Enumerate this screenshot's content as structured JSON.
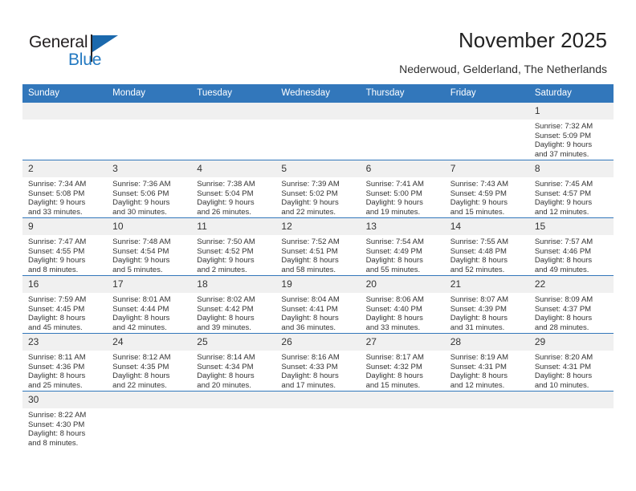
{
  "brand": {
    "name_part1": "General",
    "name_part2": "Blue",
    "flag_icon": "blue-triangle-flag-icon",
    "colors": {
      "dark": "#231f20",
      "blue": "#2379c1",
      "flag": "#1b69ad"
    }
  },
  "header": {
    "title": "November 2025",
    "subtitle": "Nederwoud, Gelderland, The Netherlands"
  },
  "calendar": {
    "accent_color": "#3277bb",
    "daynum_bg": "#f0f0f0",
    "weekday_headers": [
      "Sunday",
      "Monday",
      "Tuesday",
      "Wednesday",
      "Thursday",
      "Friday",
      "Saturday"
    ],
    "weeks": [
      [
        {
          "empty": true
        },
        {
          "empty": true
        },
        {
          "empty": true
        },
        {
          "empty": true
        },
        {
          "empty": true
        },
        {
          "empty": true
        },
        {
          "day": "1",
          "sunrise": "Sunrise: 7:32 AM",
          "sunset": "Sunset: 5:09 PM",
          "daylight1": "Daylight: 9 hours",
          "daylight2": "and 37 minutes."
        }
      ],
      [
        {
          "day": "2",
          "sunrise": "Sunrise: 7:34 AM",
          "sunset": "Sunset: 5:08 PM",
          "daylight1": "Daylight: 9 hours",
          "daylight2": "and 33 minutes."
        },
        {
          "day": "3",
          "sunrise": "Sunrise: 7:36 AM",
          "sunset": "Sunset: 5:06 PM",
          "daylight1": "Daylight: 9 hours",
          "daylight2": "and 30 minutes."
        },
        {
          "day": "4",
          "sunrise": "Sunrise: 7:38 AM",
          "sunset": "Sunset: 5:04 PM",
          "daylight1": "Daylight: 9 hours",
          "daylight2": "and 26 minutes."
        },
        {
          "day": "5",
          "sunrise": "Sunrise: 7:39 AM",
          "sunset": "Sunset: 5:02 PM",
          "daylight1": "Daylight: 9 hours",
          "daylight2": "and 22 minutes."
        },
        {
          "day": "6",
          "sunrise": "Sunrise: 7:41 AM",
          "sunset": "Sunset: 5:00 PM",
          "daylight1": "Daylight: 9 hours",
          "daylight2": "and 19 minutes."
        },
        {
          "day": "7",
          "sunrise": "Sunrise: 7:43 AM",
          "sunset": "Sunset: 4:59 PM",
          "daylight1": "Daylight: 9 hours",
          "daylight2": "and 15 minutes."
        },
        {
          "day": "8",
          "sunrise": "Sunrise: 7:45 AM",
          "sunset": "Sunset: 4:57 PM",
          "daylight1": "Daylight: 9 hours",
          "daylight2": "and 12 minutes."
        }
      ],
      [
        {
          "day": "9",
          "sunrise": "Sunrise: 7:47 AM",
          "sunset": "Sunset: 4:55 PM",
          "daylight1": "Daylight: 9 hours",
          "daylight2": "and 8 minutes."
        },
        {
          "day": "10",
          "sunrise": "Sunrise: 7:48 AM",
          "sunset": "Sunset: 4:54 PM",
          "daylight1": "Daylight: 9 hours",
          "daylight2": "and 5 minutes."
        },
        {
          "day": "11",
          "sunrise": "Sunrise: 7:50 AM",
          "sunset": "Sunset: 4:52 PM",
          "daylight1": "Daylight: 9 hours",
          "daylight2": "and 2 minutes."
        },
        {
          "day": "12",
          "sunrise": "Sunrise: 7:52 AM",
          "sunset": "Sunset: 4:51 PM",
          "daylight1": "Daylight: 8 hours",
          "daylight2": "and 58 minutes."
        },
        {
          "day": "13",
          "sunrise": "Sunrise: 7:54 AM",
          "sunset": "Sunset: 4:49 PM",
          "daylight1": "Daylight: 8 hours",
          "daylight2": "and 55 minutes."
        },
        {
          "day": "14",
          "sunrise": "Sunrise: 7:55 AM",
          "sunset": "Sunset: 4:48 PM",
          "daylight1": "Daylight: 8 hours",
          "daylight2": "and 52 minutes."
        },
        {
          "day": "15",
          "sunrise": "Sunrise: 7:57 AM",
          "sunset": "Sunset: 4:46 PM",
          "daylight1": "Daylight: 8 hours",
          "daylight2": "and 49 minutes."
        }
      ],
      [
        {
          "day": "16",
          "sunrise": "Sunrise: 7:59 AM",
          "sunset": "Sunset: 4:45 PM",
          "daylight1": "Daylight: 8 hours",
          "daylight2": "and 45 minutes."
        },
        {
          "day": "17",
          "sunrise": "Sunrise: 8:01 AM",
          "sunset": "Sunset: 4:44 PM",
          "daylight1": "Daylight: 8 hours",
          "daylight2": "and 42 minutes."
        },
        {
          "day": "18",
          "sunrise": "Sunrise: 8:02 AM",
          "sunset": "Sunset: 4:42 PM",
          "daylight1": "Daylight: 8 hours",
          "daylight2": "and 39 minutes."
        },
        {
          "day": "19",
          "sunrise": "Sunrise: 8:04 AM",
          "sunset": "Sunset: 4:41 PM",
          "daylight1": "Daylight: 8 hours",
          "daylight2": "and 36 minutes."
        },
        {
          "day": "20",
          "sunrise": "Sunrise: 8:06 AM",
          "sunset": "Sunset: 4:40 PM",
          "daylight1": "Daylight: 8 hours",
          "daylight2": "and 33 minutes."
        },
        {
          "day": "21",
          "sunrise": "Sunrise: 8:07 AM",
          "sunset": "Sunset: 4:39 PM",
          "daylight1": "Daylight: 8 hours",
          "daylight2": "and 31 minutes."
        },
        {
          "day": "22",
          "sunrise": "Sunrise: 8:09 AM",
          "sunset": "Sunset: 4:37 PM",
          "daylight1": "Daylight: 8 hours",
          "daylight2": "and 28 minutes."
        }
      ],
      [
        {
          "day": "23",
          "sunrise": "Sunrise: 8:11 AM",
          "sunset": "Sunset: 4:36 PM",
          "daylight1": "Daylight: 8 hours",
          "daylight2": "and 25 minutes."
        },
        {
          "day": "24",
          "sunrise": "Sunrise: 8:12 AM",
          "sunset": "Sunset: 4:35 PM",
          "daylight1": "Daylight: 8 hours",
          "daylight2": "and 22 minutes."
        },
        {
          "day": "25",
          "sunrise": "Sunrise: 8:14 AM",
          "sunset": "Sunset: 4:34 PM",
          "daylight1": "Daylight: 8 hours",
          "daylight2": "and 20 minutes."
        },
        {
          "day": "26",
          "sunrise": "Sunrise: 8:16 AM",
          "sunset": "Sunset: 4:33 PM",
          "daylight1": "Daylight: 8 hours",
          "daylight2": "and 17 minutes."
        },
        {
          "day": "27",
          "sunrise": "Sunrise: 8:17 AM",
          "sunset": "Sunset: 4:32 PM",
          "daylight1": "Daylight: 8 hours",
          "daylight2": "and 15 minutes."
        },
        {
          "day": "28",
          "sunrise": "Sunrise: 8:19 AM",
          "sunset": "Sunset: 4:31 PM",
          "daylight1": "Daylight: 8 hours",
          "daylight2": "and 12 minutes."
        },
        {
          "day": "29",
          "sunrise": "Sunrise: 8:20 AM",
          "sunset": "Sunset: 4:31 PM",
          "daylight1": "Daylight: 8 hours",
          "daylight2": "and 10 minutes."
        }
      ],
      [
        {
          "day": "30",
          "sunrise": "Sunrise: 8:22 AM",
          "sunset": "Sunset: 4:30 PM",
          "daylight1": "Daylight: 8 hours",
          "daylight2": "and 8 minutes."
        },
        {
          "empty": true
        },
        {
          "empty": true
        },
        {
          "empty": true
        },
        {
          "empty": true
        },
        {
          "empty": true
        },
        {
          "empty": true
        }
      ]
    ]
  }
}
